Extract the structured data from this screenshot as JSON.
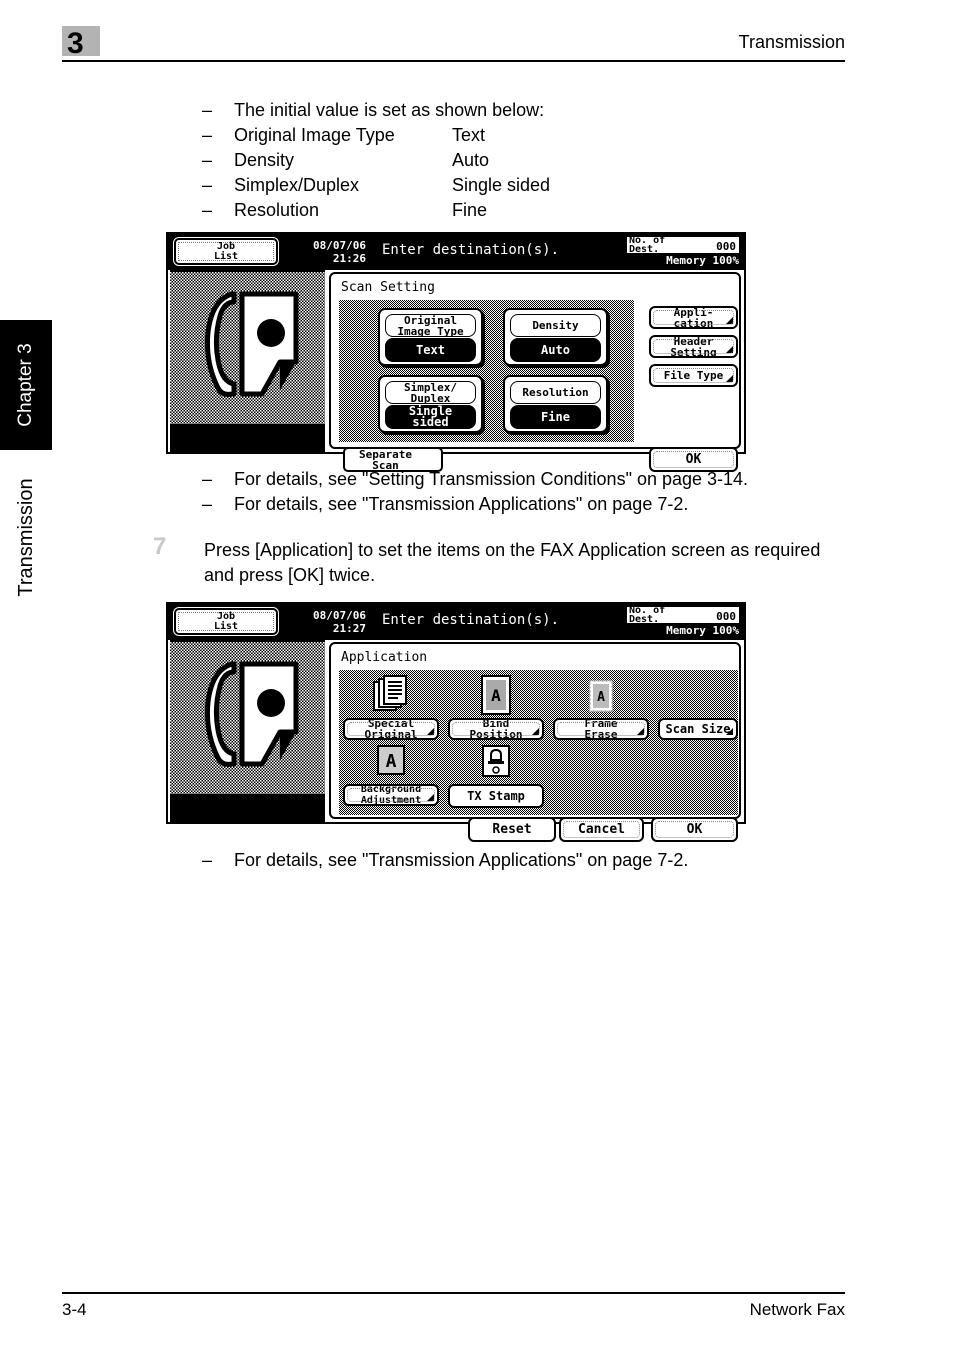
{
  "header": {
    "chapter_number": "3",
    "title": "Transmission"
  },
  "sidebar": {
    "chapter_tab": "Chapter 3",
    "section_label": "Transmission"
  },
  "footer": {
    "page_number": "3-4",
    "doc_title": "Network Fax"
  },
  "body": {
    "initial_values": {
      "intro": "The initial value is set as shown below:",
      "dash": "–",
      "rows": [
        {
          "term": "Original Image Type",
          "value": "Text"
        },
        {
          "term": "Density",
          "value": "Auto"
        },
        {
          "term": "Simplex/Duplex",
          "value": "Single sided"
        },
        {
          "term": "Resolution",
          "value": "Fine"
        }
      ]
    },
    "refs_after_panel1": [
      "For details, see \"Setting Transmission Conditions\" on page 3-14.",
      "For details, see \"Transmission Applications\" on page 7-2."
    ],
    "step7": {
      "number": "7",
      "text": "Press [Application] to set the items on the FAX Application screen as required and press [OK] twice."
    },
    "refs_after_panel2": [
      "For details, see \"Transmission Applications\" on page 7-2."
    ]
  },
  "panel1": {
    "topbar": {
      "job_list_line1": "Job",
      "job_list_line2": "List",
      "date": "08/07/06",
      "time": "21:26",
      "message": "Enter destination(s).",
      "dest_label_line1": "No. of",
      "dest_label_line2": "Dest.",
      "dest_value": "000",
      "memory": "Memory 100%"
    },
    "section_title": "Scan Setting",
    "settings": [
      {
        "title": "Original\nImage Type",
        "value": "Text"
      },
      {
        "title": "Density",
        "value": "Auto"
      },
      {
        "title": "Simplex/\nDuplex",
        "value": "Single\nsided"
      },
      {
        "title": "Resolution",
        "value": "Fine"
      }
    ],
    "side_buttons": [
      {
        "label": "Appli-\ncation",
        "has_corner": true
      },
      {
        "label": "Header\nSetting",
        "has_corner": true
      },
      {
        "label": "File Type",
        "has_corner": true
      }
    ],
    "separate_scan": "Separate\nScan",
    "ok": "OK"
  },
  "panel2": {
    "topbar": {
      "job_list_line1": "Job",
      "job_list_line2": "List",
      "date": "08/07/06",
      "time": "21:27",
      "message": "Enter destination(s).",
      "dest_label_line1": "No. of",
      "dest_label_line2": "Dest.",
      "dest_value": "000",
      "memory": "Memory 100%"
    },
    "section_title": "Application",
    "tiles": [
      {
        "label": "Special\nOriginal",
        "icon": "stacked-pages-icon",
        "has_corner": true
      },
      {
        "label": "Bind\nPosition",
        "icon": "bind-position-page-icon",
        "has_corner": true
      },
      {
        "label": "Frame\nErase",
        "icon": "frame-erase-page-icon",
        "has_corner": true
      },
      {
        "label": "Scan Size",
        "icon": "none",
        "has_corner": true
      },
      {
        "label": "Background\nAdjustment",
        "icon": "background-letter-a-icon",
        "has_corner": true
      },
      {
        "label": "TX Stamp",
        "icon": "stamp-icon",
        "has_corner": false
      }
    ],
    "reset": "Reset",
    "cancel": "Cancel",
    "ok": "OK"
  },
  "colors": {
    "chapter_box": "#b3b3b3",
    "step_number": "#c8c8c8",
    "tab_background": "#000000",
    "lcd_background": "#ffffff",
    "lcd_foreground": "#000000"
  }
}
